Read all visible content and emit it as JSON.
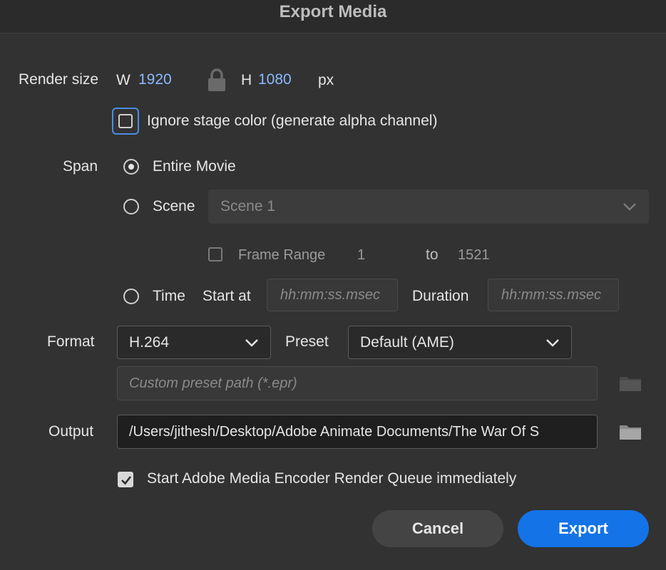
{
  "dialog": {
    "title": "Export Media"
  },
  "render_size": {
    "label": "Render size",
    "w_label": "W",
    "width": "1920",
    "h_label": "H",
    "height": "1080",
    "unit": "px",
    "lock_icon": "lock-icon"
  },
  "ignore_stage": {
    "label": "Ignore stage color (generate alpha channel)",
    "checked": false
  },
  "span": {
    "label": "Span",
    "entire_movie": "Entire Movie",
    "scene": "Scene",
    "scene_value": "Scene 1",
    "frame_range_label": "Frame Range",
    "frame_from": "1",
    "to_label": "to",
    "frame_to": "1521",
    "time": "Time",
    "start_at_label": "Start at",
    "start_placeholder": "hh:mm:ss.msec",
    "duration_label": "Duration",
    "duration_placeholder": "hh:mm:ss.msec",
    "selected": "Entire Movie"
  },
  "format": {
    "label": "Format",
    "value": "H.264",
    "preset_label": "Preset",
    "preset_value": "Default (AME)",
    "custom_preset_placeholder": "Custom preset path (*.epr)"
  },
  "output": {
    "label": "Output",
    "path": "/Users/jithesh/Desktop/Adobe Animate Documents/The War Of S",
    "folder_icon": "folder-icon"
  },
  "queue": {
    "label": "Start Adobe Media Encoder Render Queue immediately",
    "checked": true
  },
  "buttons": {
    "cancel": "Cancel",
    "export": "Export"
  },
  "colors": {
    "accent": "#1473e6",
    "focus": "#4a8de6",
    "value_blue": "#8ab8ff"
  }
}
